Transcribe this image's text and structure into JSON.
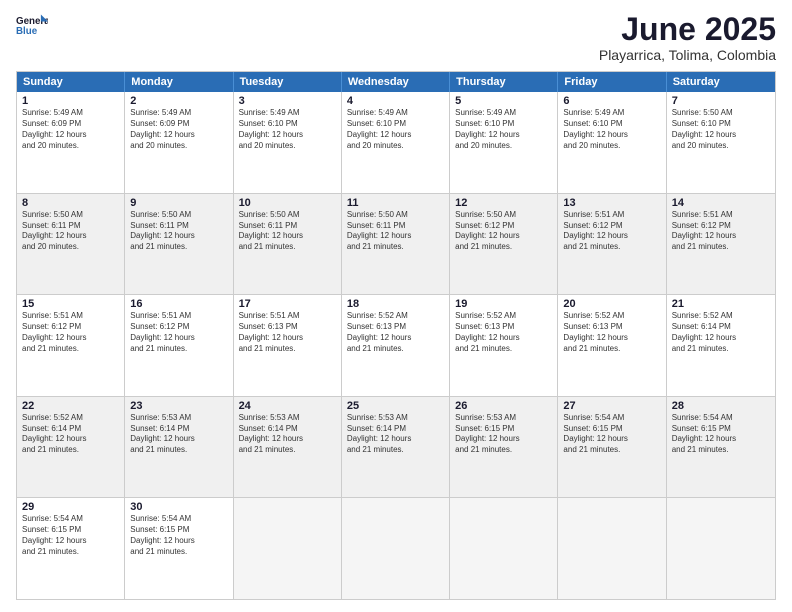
{
  "logo": {
    "line1": "General",
    "line2": "Blue"
  },
  "title": "June 2025",
  "subtitle": "Playarrica, Tolima, Colombia",
  "days": [
    "Sunday",
    "Monday",
    "Tuesday",
    "Wednesday",
    "Thursday",
    "Friday",
    "Saturday"
  ],
  "rows": [
    [
      {
        "day": "1",
        "sunrise": "5:49 AM",
        "sunset": "6:09 PM",
        "daylight": "12 hours and 20 minutes.",
        "shaded": false
      },
      {
        "day": "2",
        "sunrise": "5:49 AM",
        "sunset": "6:09 PM",
        "daylight": "12 hours and 20 minutes.",
        "shaded": false
      },
      {
        "day": "3",
        "sunrise": "5:49 AM",
        "sunset": "6:10 PM",
        "daylight": "12 hours and 20 minutes.",
        "shaded": false
      },
      {
        "day": "4",
        "sunrise": "5:49 AM",
        "sunset": "6:10 PM",
        "daylight": "12 hours and 20 minutes.",
        "shaded": false
      },
      {
        "day": "5",
        "sunrise": "5:49 AM",
        "sunset": "6:10 PM",
        "daylight": "12 hours and 20 minutes.",
        "shaded": false
      },
      {
        "day": "6",
        "sunrise": "5:49 AM",
        "sunset": "6:10 PM",
        "daylight": "12 hours and 20 minutes.",
        "shaded": false
      },
      {
        "day": "7",
        "sunrise": "5:50 AM",
        "sunset": "6:10 PM",
        "daylight": "12 hours and 20 minutes.",
        "shaded": false
      }
    ],
    [
      {
        "day": "8",
        "sunrise": "5:50 AM",
        "sunset": "6:11 PM",
        "daylight": "12 hours and 20 minutes.",
        "shaded": true
      },
      {
        "day": "9",
        "sunrise": "5:50 AM",
        "sunset": "6:11 PM",
        "daylight": "12 hours and 21 minutes.",
        "shaded": true
      },
      {
        "day": "10",
        "sunrise": "5:50 AM",
        "sunset": "6:11 PM",
        "daylight": "12 hours and 21 minutes.",
        "shaded": true
      },
      {
        "day": "11",
        "sunrise": "5:50 AM",
        "sunset": "6:11 PM",
        "daylight": "12 hours and 21 minutes.",
        "shaded": true
      },
      {
        "day": "12",
        "sunrise": "5:50 AM",
        "sunset": "6:12 PM",
        "daylight": "12 hours and 21 minutes.",
        "shaded": true
      },
      {
        "day": "13",
        "sunrise": "5:51 AM",
        "sunset": "6:12 PM",
        "daylight": "12 hours and 21 minutes.",
        "shaded": true
      },
      {
        "day": "14",
        "sunrise": "5:51 AM",
        "sunset": "6:12 PM",
        "daylight": "12 hours and 21 minutes.",
        "shaded": true
      }
    ],
    [
      {
        "day": "15",
        "sunrise": "5:51 AM",
        "sunset": "6:12 PM",
        "daylight": "12 hours and 21 minutes.",
        "shaded": false
      },
      {
        "day": "16",
        "sunrise": "5:51 AM",
        "sunset": "6:12 PM",
        "daylight": "12 hours and 21 minutes.",
        "shaded": false
      },
      {
        "day": "17",
        "sunrise": "5:51 AM",
        "sunset": "6:13 PM",
        "daylight": "12 hours and 21 minutes.",
        "shaded": false
      },
      {
        "day": "18",
        "sunrise": "5:52 AM",
        "sunset": "6:13 PM",
        "daylight": "12 hours and 21 minutes.",
        "shaded": false
      },
      {
        "day": "19",
        "sunrise": "5:52 AM",
        "sunset": "6:13 PM",
        "daylight": "12 hours and 21 minutes.",
        "shaded": false
      },
      {
        "day": "20",
        "sunrise": "5:52 AM",
        "sunset": "6:13 PM",
        "daylight": "12 hours and 21 minutes.",
        "shaded": false
      },
      {
        "day": "21",
        "sunrise": "5:52 AM",
        "sunset": "6:14 PM",
        "daylight": "12 hours and 21 minutes.",
        "shaded": false
      }
    ],
    [
      {
        "day": "22",
        "sunrise": "5:52 AM",
        "sunset": "6:14 PM",
        "daylight": "12 hours and 21 minutes.",
        "shaded": true
      },
      {
        "day": "23",
        "sunrise": "5:53 AM",
        "sunset": "6:14 PM",
        "daylight": "12 hours and 21 minutes.",
        "shaded": true
      },
      {
        "day": "24",
        "sunrise": "5:53 AM",
        "sunset": "6:14 PM",
        "daylight": "12 hours and 21 minutes.",
        "shaded": true
      },
      {
        "day": "25",
        "sunrise": "5:53 AM",
        "sunset": "6:14 PM",
        "daylight": "12 hours and 21 minutes.",
        "shaded": true
      },
      {
        "day": "26",
        "sunrise": "5:53 AM",
        "sunset": "6:15 PM",
        "daylight": "12 hours and 21 minutes.",
        "shaded": true
      },
      {
        "day": "27",
        "sunrise": "5:54 AM",
        "sunset": "6:15 PM",
        "daylight": "12 hours and 21 minutes.",
        "shaded": true
      },
      {
        "day": "28",
        "sunrise": "5:54 AM",
        "sunset": "6:15 PM",
        "daylight": "12 hours and 21 minutes.",
        "shaded": true
      }
    ],
    [
      {
        "day": "29",
        "sunrise": "5:54 AM",
        "sunset": "6:15 PM",
        "daylight": "12 hours and 21 minutes.",
        "shaded": false
      },
      {
        "day": "30",
        "sunrise": "5:54 AM",
        "sunset": "6:15 PM",
        "daylight": "12 hours and 21 minutes.",
        "shaded": false
      },
      {
        "day": "",
        "sunrise": "",
        "sunset": "",
        "daylight": "",
        "shaded": false,
        "empty": true
      },
      {
        "day": "",
        "sunrise": "",
        "sunset": "",
        "daylight": "",
        "shaded": false,
        "empty": true
      },
      {
        "day": "",
        "sunrise": "",
        "sunset": "",
        "daylight": "",
        "shaded": false,
        "empty": true
      },
      {
        "day": "",
        "sunrise": "",
        "sunset": "",
        "daylight": "",
        "shaded": false,
        "empty": true
      },
      {
        "day": "",
        "sunrise": "",
        "sunset": "",
        "daylight": "",
        "shaded": false,
        "empty": true
      }
    ]
  ]
}
